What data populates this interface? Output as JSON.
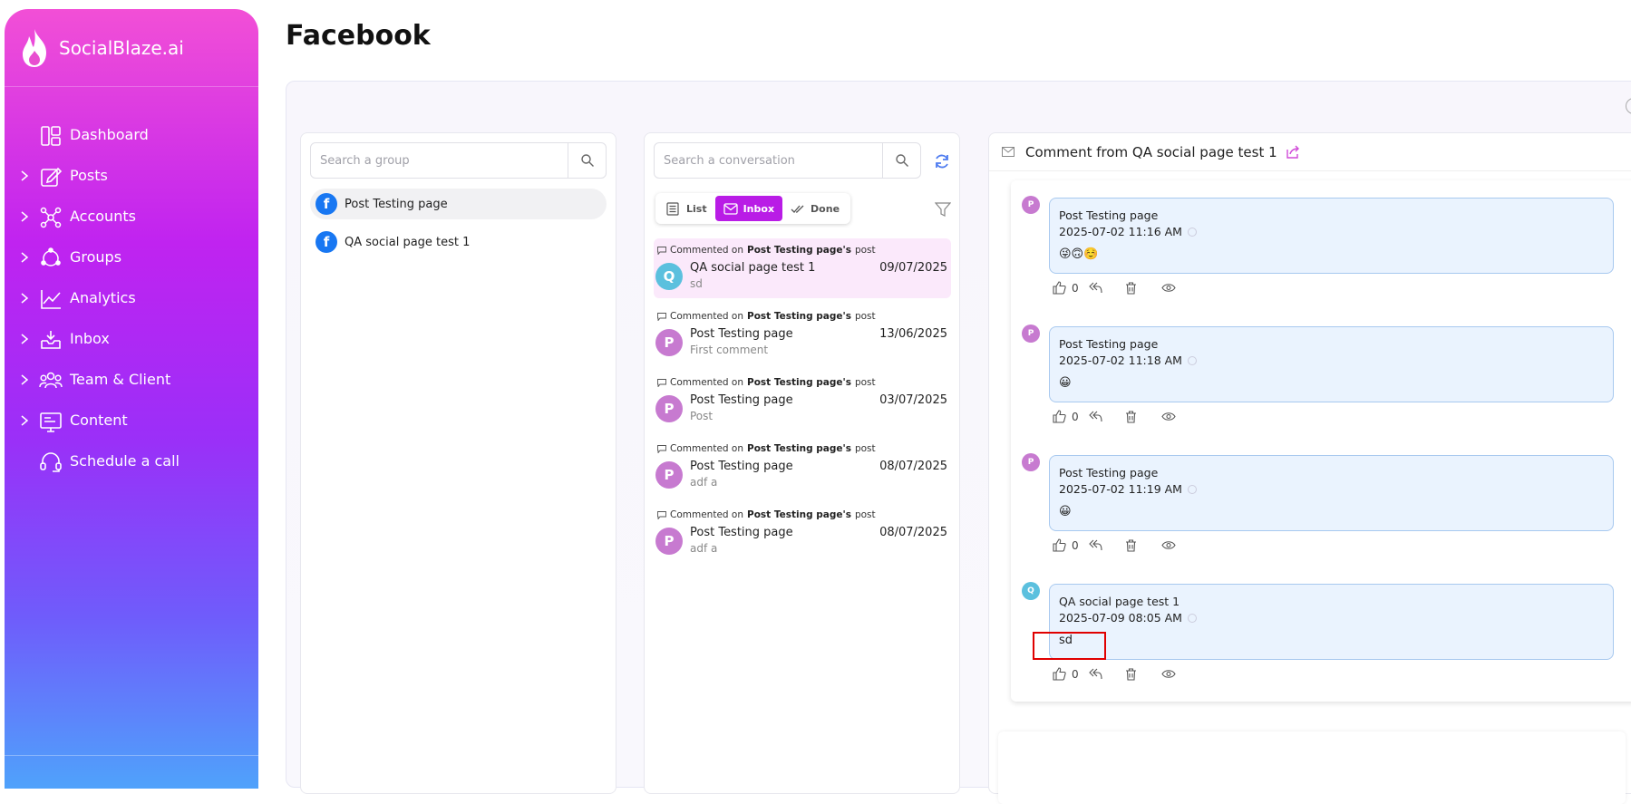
{
  "brand": {
    "name": "SocialBlaze.ai"
  },
  "sidebar": {
    "items": [
      {
        "label": "Dashboard",
        "icon": "dashboard-icon",
        "chevron": false
      },
      {
        "label": "Posts",
        "icon": "edit-icon",
        "chevron": true
      },
      {
        "label": "Accounts",
        "icon": "network-icon",
        "chevron": true
      },
      {
        "label": "Groups",
        "icon": "groups-icon",
        "chevron": true
      },
      {
        "label": "Analytics",
        "icon": "analytics-icon",
        "chevron": true
      },
      {
        "label": "Inbox",
        "icon": "inbox-icon",
        "chevron": true
      },
      {
        "label": "Team & Client",
        "icon": "team-icon",
        "chevron": true
      },
      {
        "label": "Content",
        "icon": "content-icon",
        "chevron": true
      },
      {
        "label": "Schedule a call",
        "icon": "headset-icon",
        "chevron": false
      }
    ]
  },
  "page": {
    "title": "Facebook"
  },
  "groups": {
    "search_placeholder": "Search a group",
    "items": [
      {
        "name": "Post Testing page",
        "active": true
      },
      {
        "name": "QA social page test 1",
        "active": false
      }
    ]
  },
  "conversations": {
    "search_placeholder": "Search a conversation",
    "tabs": [
      {
        "label": "List",
        "active": false
      },
      {
        "label": "Inbox",
        "active": true
      },
      {
        "label": "Done",
        "active": false
      }
    ],
    "meta_prefix": "Commented on",
    "meta_page": "Post Testing page's",
    "meta_suffix": "post",
    "items": [
      {
        "avatar": "Q",
        "avatar_color": "#5bc0de",
        "name": "QA social page test 1",
        "snippet": "sd",
        "date": "09/07/2025",
        "active": true
      },
      {
        "avatar": "P",
        "avatar_color": "#c77ad0",
        "name": "Post Testing page",
        "snippet": "First comment",
        "date": "13/06/2025",
        "active": false
      },
      {
        "avatar": "P",
        "avatar_color": "#c77ad0",
        "name": "Post Testing page",
        "snippet": "Post",
        "date": "03/07/2025",
        "active": false
      },
      {
        "avatar": "P",
        "avatar_color": "#c77ad0",
        "name": "Post Testing page",
        "snippet": "adf a",
        "date": "08/07/2025",
        "active": false
      },
      {
        "avatar": "P",
        "avatar_color": "#c77ad0",
        "name": "Post Testing page",
        "snippet": "adf a",
        "date": "08/07/2025",
        "active": false
      }
    ]
  },
  "detail": {
    "header": "Comment from QA social page test 1",
    "messages": [
      {
        "avatar": "P",
        "avatar_color": "#c77ad0",
        "author": "Post Testing page",
        "time": "2025-07-02 11:16 AM",
        "body": "😜🙃☺️",
        "likes": "0"
      },
      {
        "avatar": "P",
        "avatar_color": "#c77ad0",
        "author": "Post Testing page",
        "time": "2025-07-02 11:18 AM",
        "body": "😀",
        "likes": "0"
      },
      {
        "avatar": "P",
        "avatar_color": "#c77ad0",
        "author": "Post Testing page",
        "time": "2025-07-02 11:19 AM",
        "body": "😀",
        "likes": "0"
      },
      {
        "avatar": "Q",
        "avatar_color": "#5bc0de",
        "author": "QA social page test 1",
        "time": "2025-07-09 08:05 AM",
        "body": "sd",
        "likes": "0"
      }
    ]
  },
  "colors": {
    "accent": "#b91ce6",
    "facebook": "#1877f2",
    "bubble_bg": "#eaf3fe",
    "bubble_border": "#a8c9ef",
    "highlight": "#e00000"
  }
}
